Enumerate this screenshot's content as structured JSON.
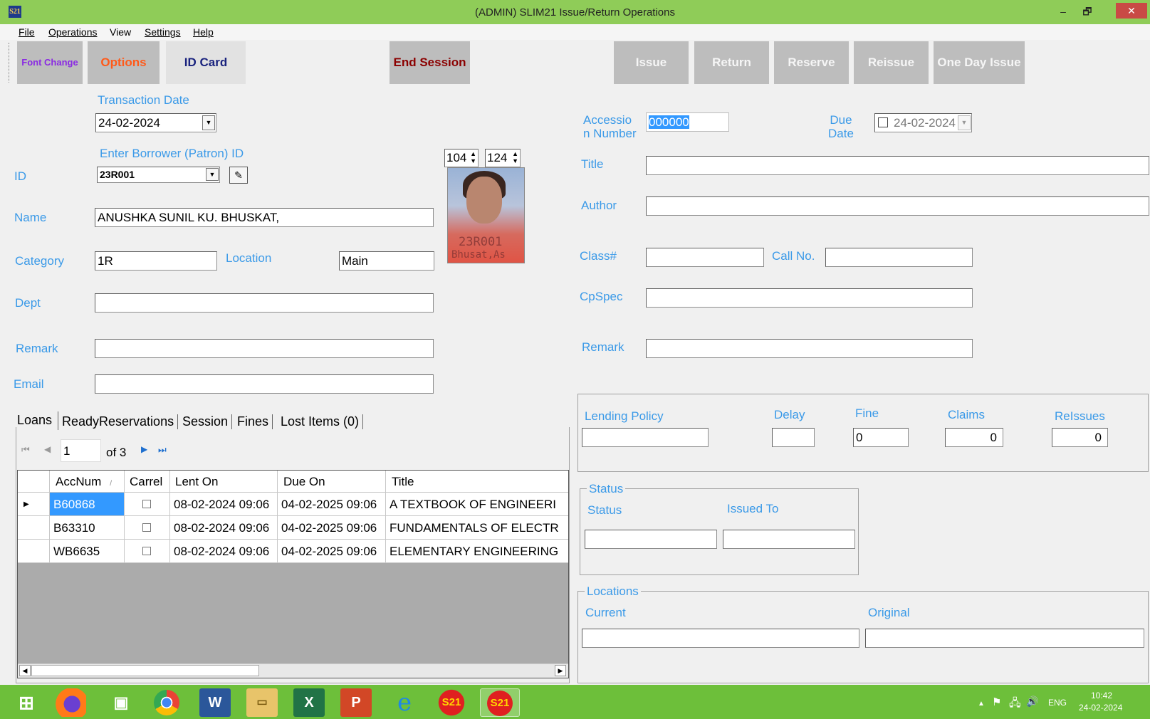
{
  "window": {
    "title": "(ADMIN) SLIM21 Issue/Return Operations",
    "logo_text": "S21",
    "min": "–",
    "restore": "🗗",
    "close": "✕"
  },
  "menu": [
    "File",
    "Operations",
    "View",
    "Settings",
    "Help"
  ],
  "toolbar": {
    "font_change": "Font Change",
    "options": "Options",
    "id_card": "ID Card",
    "end_session": "End Session",
    "issue": "Issue",
    "return": "Return",
    "reserve": "Reserve",
    "reissue": "Reissue",
    "one_day_issue": "One Day Issue"
  },
  "colors": {
    "font_change": "#8a2be2",
    "options": "#ff5a1a",
    "id_card": "#1a237e",
    "end_session": "#8b0000",
    "label": "#3b9ae8"
  },
  "borrower": {
    "transaction_date_label": "Transaction Date",
    "transaction_date": "24-02-2024",
    "enter_id_label": "Enter Borrower (Patron) ID",
    "id_label": "ID",
    "id_value": "23R001",
    "photo_w": "104",
    "photo_h": "124",
    "photo_stamp": "23R001",
    "photo_stamp2": "Bhusat,As",
    "name_label": "Name",
    "name": "ANUSHKA SUNIL KU. BHUSKAT,",
    "category_label": "Category",
    "category": "1R",
    "location_label": "Location",
    "location": "Main",
    "dept_label": "Dept",
    "dept": "",
    "remark_label": "Remark",
    "remark": "",
    "email_label": "Email",
    "email": ""
  },
  "item": {
    "accession_label_1": "Accessio",
    "accession_label_2": "n Number",
    "accession": "000000",
    "due_label_1": "Due",
    "due_label_2": "Date",
    "due_date": "24-02-2024",
    "title_label": "Title",
    "author_label": "Author",
    "class_label": "Class#",
    "callno_label": "Call No.",
    "cpspec_label": "CpSpec",
    "remark_label": "Remark"
  },
  "policy": {
    "lending_label": "Lending Policy",
    "delay_label": "Delay",
    "fine_label": "Fine",
    "claims_label": "Claims",
    "reissues_label": "ReIssues",
    "fine": "0",
    "claims": "0",
    "reissues": "0"
  },
  "status": {
    "group": "Status",
    "status_label": "Status",
    "issued_to_label": "Issued To"
  },
  "locations": {
    "group": "Locations",
    "current_label": "Current",
    "original_label": "Original"
  },
  "tabs": [
    "Loans",
    "ReadyReservations",
    "Session",
    "Fines",
    "Lost Items (0)"
  ],
  "pager": {
    "page": "1",
    "of": "of 3"
  },
  "loans": {
    "headers": [
      "AccNum",
      "Carrel",
      "Lent On",
      "Due On",
      "Title"
    ],
    "rows": [
      {
        "acc": "B60868",
        "lent": "08-02-2024 09:06",
        "due": "04-02-2025 09:06",
        "title": "A TEXTBOOK OF ENGINEERI"
      },
      {
        "acc": "B63310",
        "lent": "08-02-2024 09:06",
        "due": "04-02-2025 09:06",
        "title": "FUNDAMENTALS OF ELECTR"
      },
      {
        "acc": "WB6635",
        "lent": "08-02-2024 09:06",
        "due": "04-02-2025 09:06",
        "title": "ELEMENTARY ENGINEERING"
      }
    ]
  },
  "taskbar": {
    "lang": "ENG",
    "time": "10:42",
    "date": "24-02-2024"
  }
}
